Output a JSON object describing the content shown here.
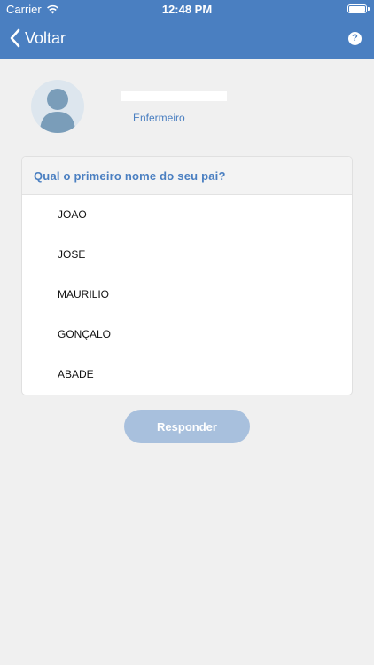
{
  "status_bar": {
    "carrier": "Carrier",
    "time": "12:48 PM"
  },
  "nav": {
    "back_label": "Voltar",
    "help_icon": "?"
  },
  "profile": {
    "role": "Enfermeiro",
    "avatar_icon": "user-silhouette-icon"
  },
  "question": {
    "text": "Qual o primeiro nome do seu pai?"
  },
  "options": [
    {
      "label": "JOAO"
    },
    {
      "label": "JOSE"
    },
    {
      "label": "MAURILIO"
    },
    {
      "label": "GONÇALO"
    },
    {
      "label": "ABADE"
    }
  ],
  "actions": {
    "respond_label": "Responder"
  },
  "colors": {
    "header": "#4a7fc1",
    "background": "#f0f0f0",
    "button_disabled": "#a8c0dd"
  }
}
